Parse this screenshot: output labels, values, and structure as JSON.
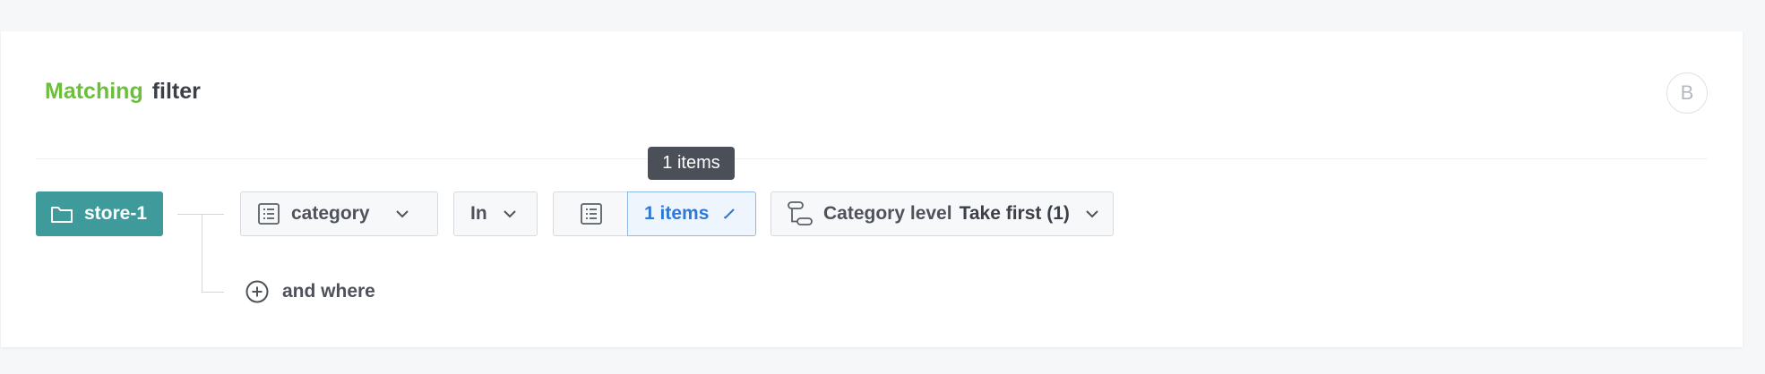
{
  "header": {
    "title_highlight": "Matching",
    "title_rest": "filter",
    "badge": "B"
  },
  "tooltip": "1 items",
  "filter": {
    "source_label": "store-1",
    "attribute_label": "category",
    "operator_label": "In",
    "items_label": "1 items",
    "level_label": "Category level",
    "level_value": "Take first (1)"
  },
  "and_where_label": "and where",
  "colors": {
    "highlight": "#6bbf3a",
    "source_chip": "#3f9b9b",
    "items_accent": "#2f78d8"
  },
  "icons": [
    "folder-icon",
    "list-icon",
    "chevron-down-icon",
    "pencil-icon",
    "hierarchy-icon",
    "plus-circle-icon"
  ]
}
